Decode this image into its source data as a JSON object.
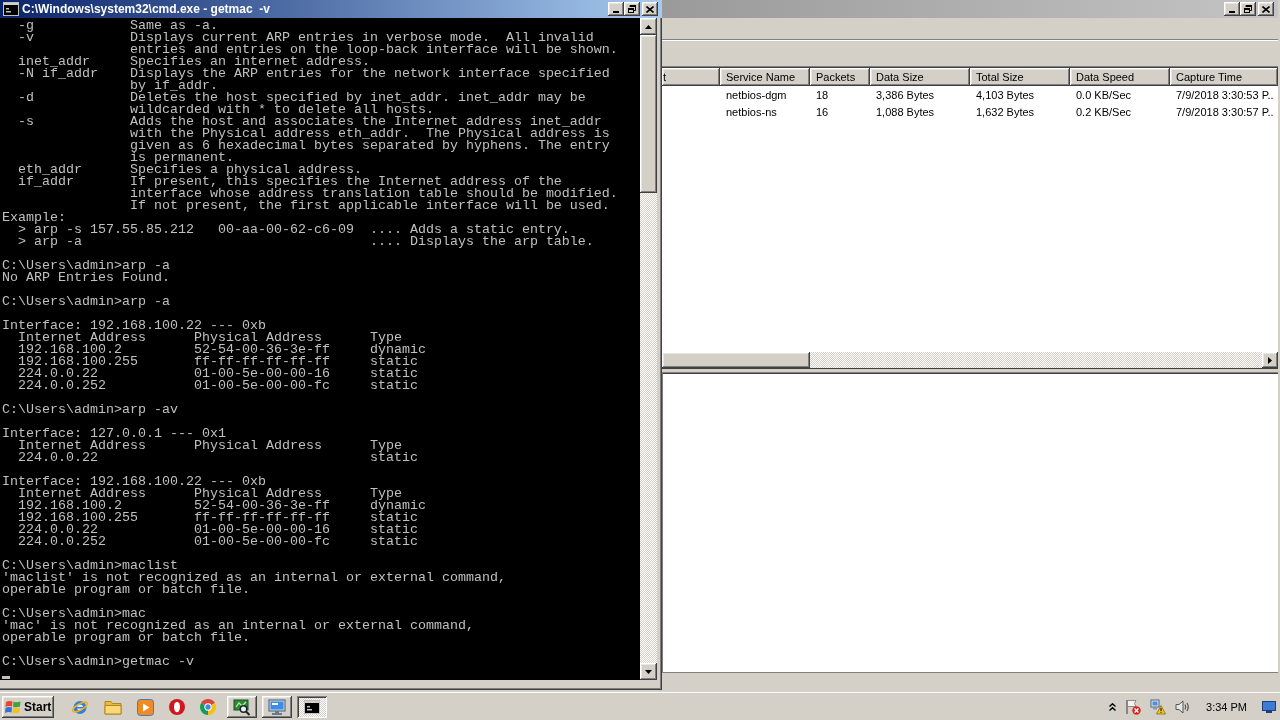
{
  "cmd_window": {
    "active": true,
    "title": "C:\\Windows\\system32\\cmd.exe - getmac  -v",
    "console_blocks": [
      [
        "  -g            Same as -a.",
        "  -v            Displays current ARP entries in verbose mode.  All invalid",
        "                entries and entries on the loop-back interface will be shown.",
        "  inet_addr     Specifies an internet address.",
        "  -N if_addr    Displays the ARP entries for the network interface specified",
        "                by if_addr.",
        "  -d            Deletes the host specified by inet_addr. inet_addr may be",
        "                wildcarded with * to delete all hosts.",
        "  -s            Adds the host and associates the Internet address inet_addr",
        "                with the Physical address eth_addr.  The Physical address is",
        "                given as 6 hexadecimal bytes separated by hyphens. The entry",
        "                is permanent.",
        "  eth_addr      Specifies a physical address.",
        "  if_addr       If present, this specifies the Internet address of the",
        "                interface whose address translation table should be modified.",
        "                If not present, the first applicable interface will be used.",
        "Example:",
        "  > arp -s 157.55.85.212   00-aa-00-62-c6-09  .... Adds a static entry.",
        "  > arp -a                                    .... Displays the arp table."
      ],
      [
        "C:\\Users\\admin>arp -a",
        "No ARP Entries Found."
      ],
      [
        "C:\\Users\\admin>arp -a"
      ],
      [
        "Interface: 192.168.100.22 --- 0xb",
        "  Internet Address      Physical Address      Type",
        "  192.168.100.2         52-54-00-36-3e-ff     dynamic",
        "  192.168.100.255       ff-ff-ff-ff-ff-ff     static",
        "  224.0.0.22            01-00-5e-00-00-16     static",
        "  224.0.0.252           01-00-5e-00-00-fc     static"
      ],
      [
        "C:\\Users\\admin>arp -av"
      ],
      [
        "Interface: 127.0.0.1 --- 0x1",
        "  Internet Address      Physical Address      Type",
        "  224.0.0.22                                  static"
      ],
      [
        "Interface: 192.168.100.22 --- 0xb",
        "  Internet Address      Physical Address      Type",
        "  192.168.100.2         52-54-00-36-3e-ff     dynamic",
        "  192.168.100.255       ff-ff-ff-ff-ff-ff     static",
        "  224.0.0.22            01-00-5e-00-00-16     static",
        "  224.0.0.252           01-00-5e-00-00-fc     static"
      ],
      [
        "C:\\Users\\admin>maclist",
        "'maclist' is not recognized as an internal or external command,",
        "operable program or batch file."
      ],
      [
        "C:\\Users\\admin>mac",
        "'mac' is not recognized as an internal or external command,",
        "operable program or batch file."
      ],
      [
        "C:\\Users\\admin>getmac -v"
      ]
    ]
  },
  "capture_window": {
    "active": false,
    "table": {
      "columns": [
        "t",
        "Service Name",
        "Packets",
        "Data Size",
        "Total Size",
        "Data Speed",
        "Capture Time"
      ],
      "rows": [
        [
          "",
          "netbios-dgm",
          "18",
          "3,386 Bytes",
          "4,103 Bytes",
          "0.0 KB/Sec",
          "7/9/2018 3:30:53 P.."
        ],
        [
          "",
          "netbios-ns",
          "16",
          "1,088 Bytes",
          "1,632 Bytes",
          "0.2 KB/Sec",
          "7/9/2018 3:30:57 P.."
        ]
      ]
    }
  },
  "taskbar": {
    "start_label": "Start",
    "tasks": [
      {
        "kind": "scanner",
        "selected": false
      },
      {
        "kind": "monitor",
        "selected": false
      },
      {
        "kind": "console",
        "selected": true
      }
    ],
    "clock": "3:34 PM"
  }
}
